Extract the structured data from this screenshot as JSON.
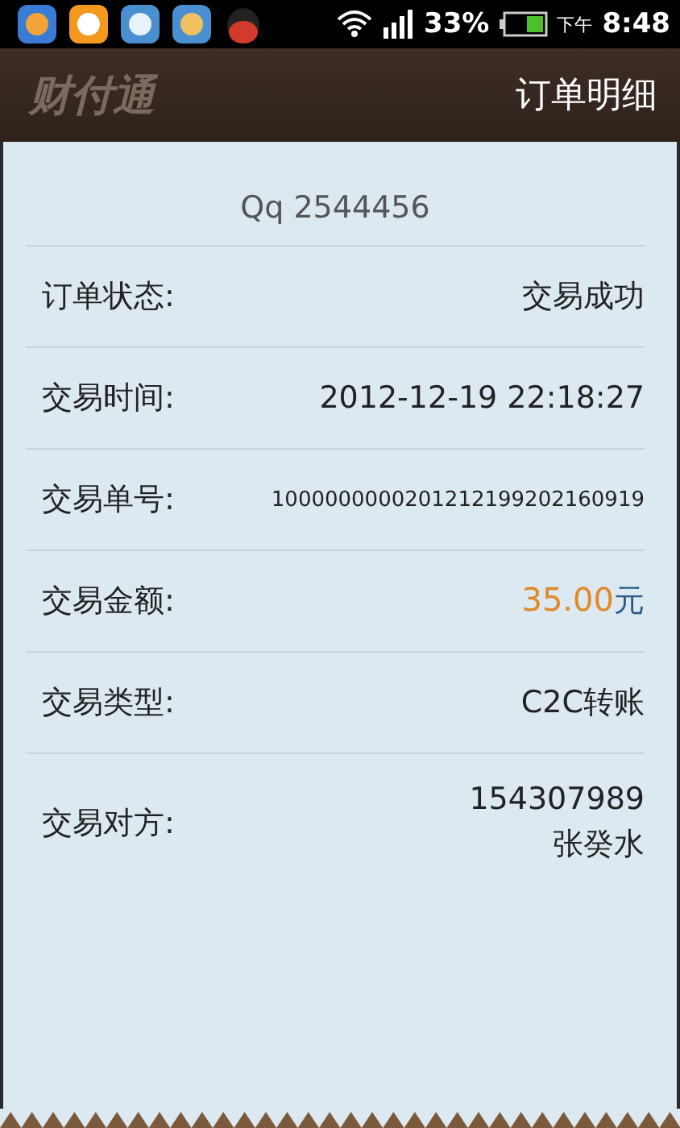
{
  "status_bar": {
    "battery_percent": "33%",
    "period": "下午",
    "time": "8:48"
  },
  "header": {
    "logo": "财付通",
    "title": "订单明细"
  },
  "account": "Qq 2544456",
  "rows": [
    {
      "kind": "text",
      "label": "订单状态:",
      "value": "交易成功"
    },
    {
      "kind": "text",
      "label": "交易时间:",
      "value": "2012-12-19 22:18:27"
    },
    {
      "kind": "small",
      "label": "交易单号:",
      "value": "1000000000201212199202160919"
    },
    {
      "kind": "amount",
      "label": "交易金额:",
      "amount": "35.00",
      "unit": "元"
    },
    {
      "kind": "text",
      "label": "交易类型:",
      "value": "C2C转账"
    },
    {
      "kind": "lines",
      "label": "交易对方:",
      "lines": [
        "154307989",
        "张癸水"
      ]
    }
  ]
}
